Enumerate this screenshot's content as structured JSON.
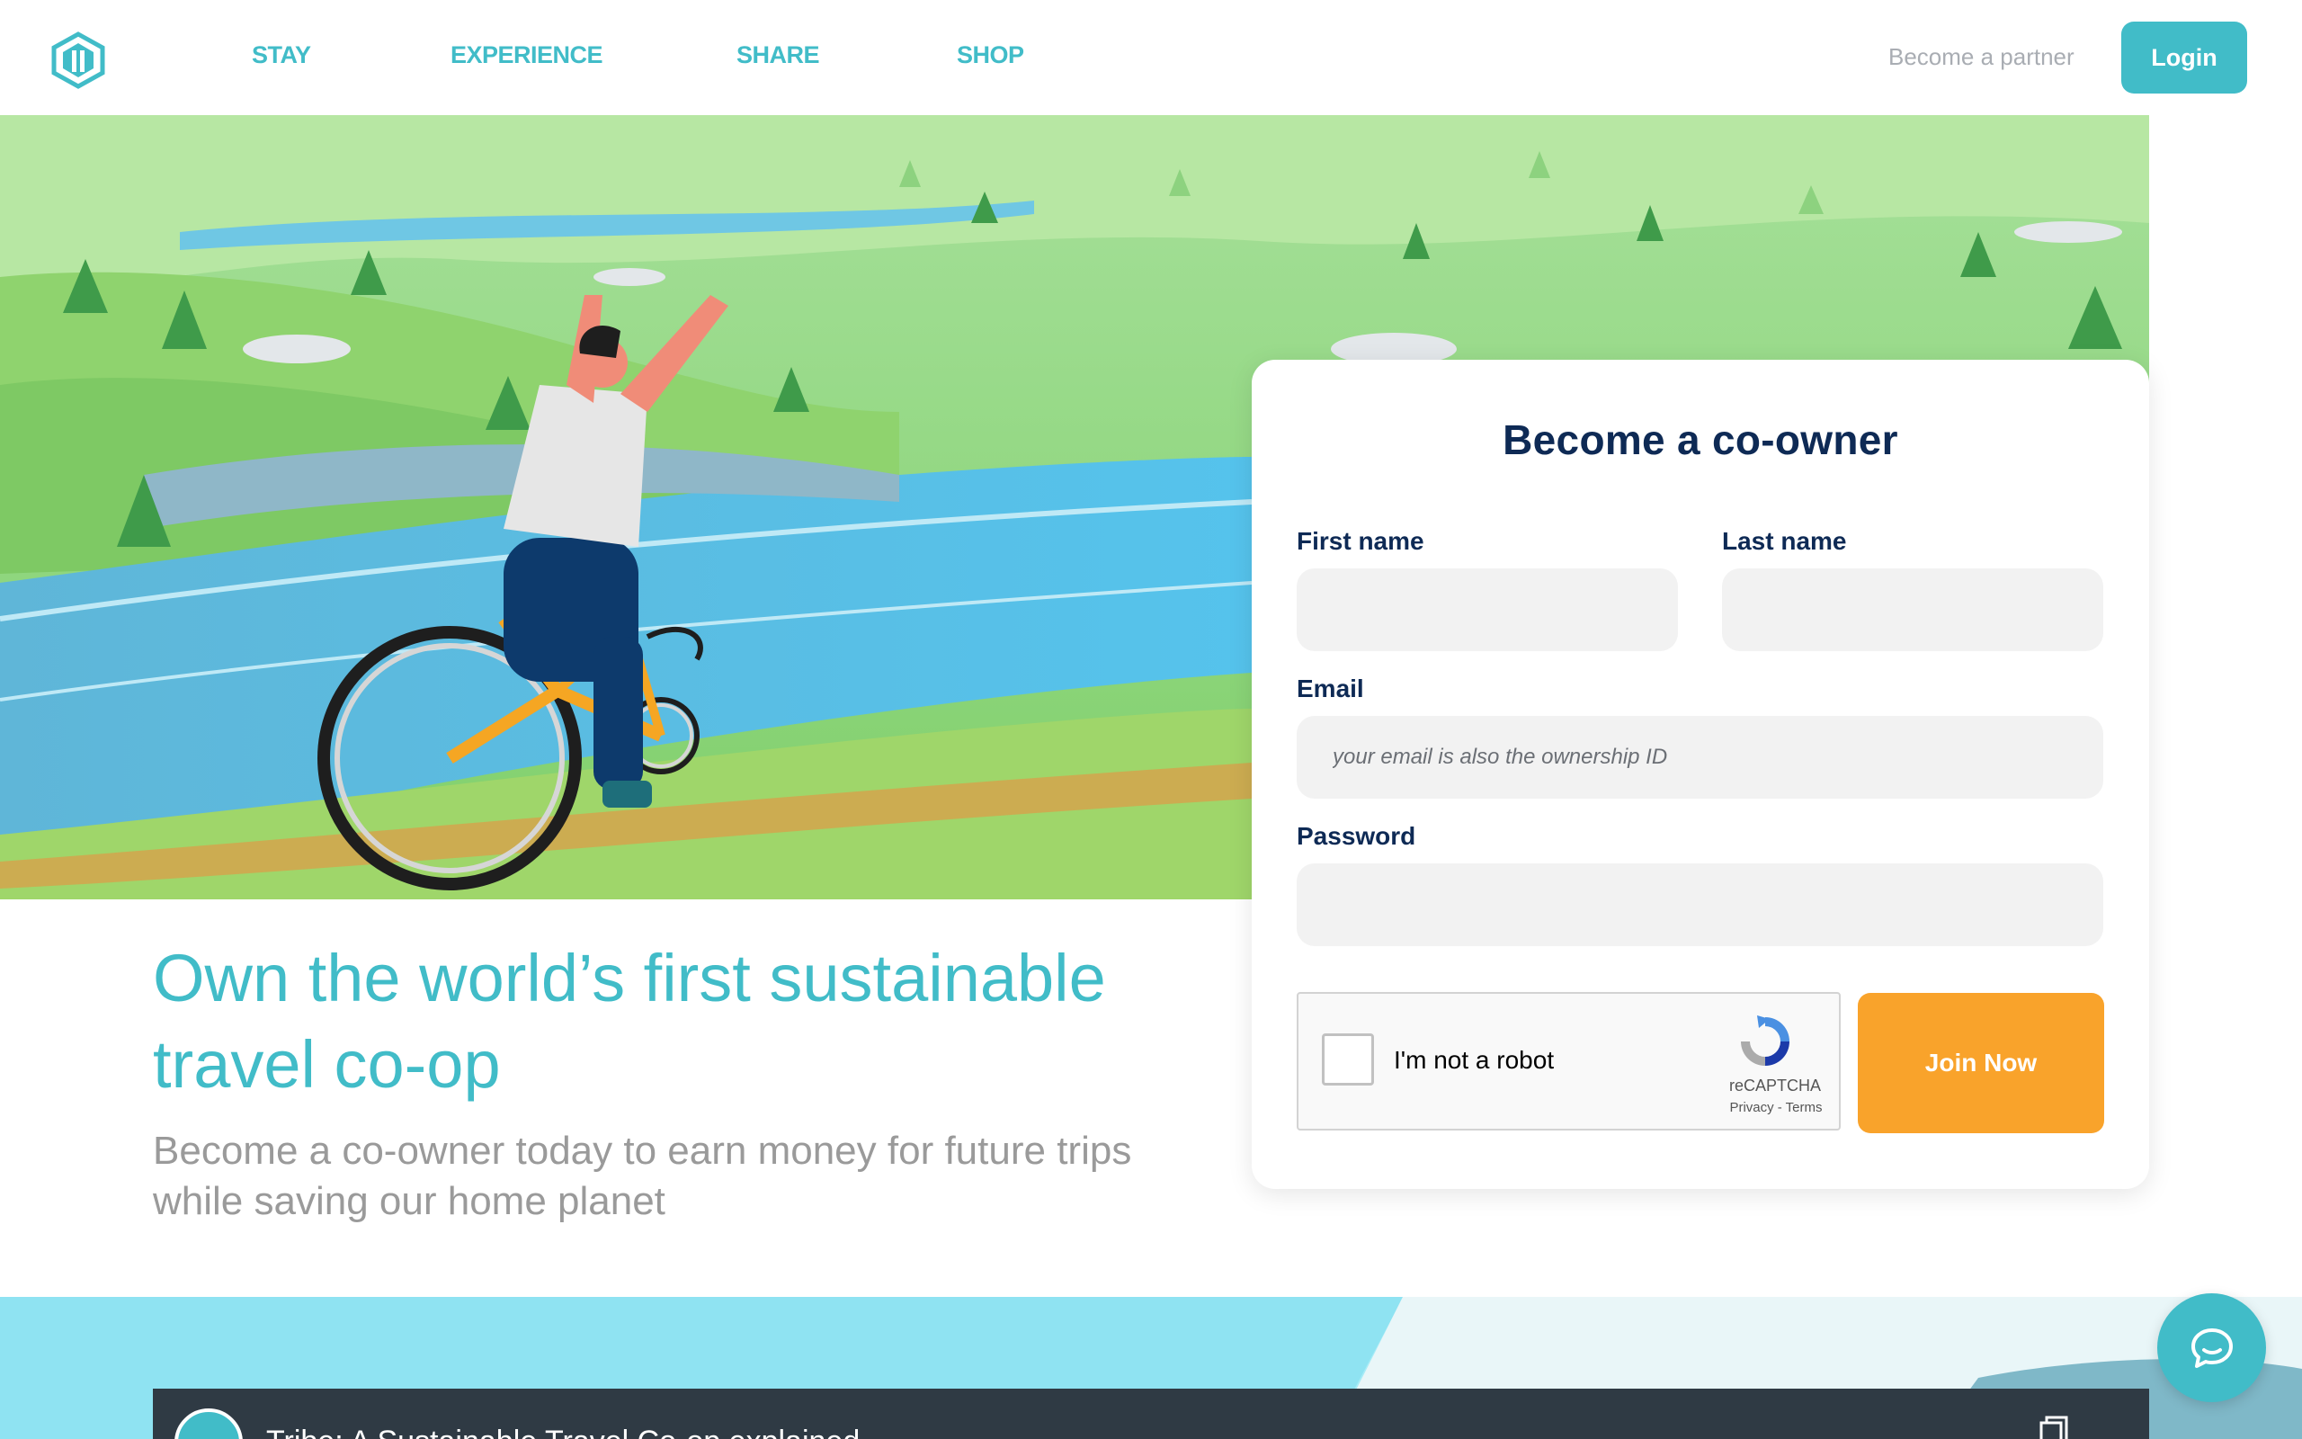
{
  "nav": {
    "logo_icon": "coop-logo-icon",
    "links": [
      "STAY",
      "EXPERIENCE",
      "SHARE",
      "SHOP"
    ],
    "partner_label": "Become a partner",
    "login_label": "Login"
  },
  "hero": {
    "headline": "Own the world’s first sustainable travel co-op",
    "subhead": "Become a co-owner today to earn money for future trips while saving our home planet"
  },
  "form": {
    "title": "Become a co-owner",
    "first_name_label": "First name",
    "last_name_label": "Last name",
    "email_label": "Email",
    "email_placeholder": "your email is also the ownership ID",
    "password_label": "Password",
    "first_name_value": "",
    "last_name_value": "",
    "email_value": "",
    "password_value": "",
    "captcha": {
      "label": "I'm not a robot",
      "brand": "reCAPTCHA",
      "links": "Privacy - Terms",
      "checked": false
    },
    "submit_label": "Join Now"
  },
  "video": {
    "title": "Tribe: A Sustainable Travel Co-op explained"
  },
  "chat": {
    "icon": "chat-bubble-icon"
  },
  "colors": {
    "brand": "#41bcc8",
    "accent": "#f9a32b",
    "heading": "#0e2a55",
    "muted": "#9a9a9a"
  }
}
